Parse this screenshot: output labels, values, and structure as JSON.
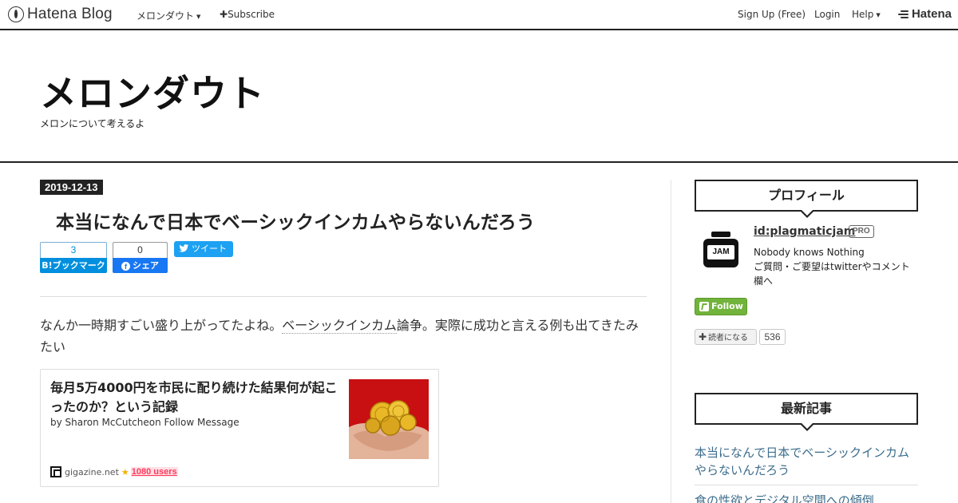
{
  "navbar": {
    "logo_text": "Hatena Blog",
    "blog_menu_label": "メロンダウト",
    "subscribe_label": "Subscribe",
    "signup_label": "Sign Up (Free)",
    "login_label": "Login",
    "help_label": "Help",
    "brand_label": "Hatena"
  },
  "header": {
    "title": "メロンダウト",
    "description": "メロンについて考えるよ"
  },
  "entry": {
    "date": "2019-12-13",
    "title": "本当になんで日本でベーシックインカムやらないんだろう",
    "bookmark": {
      "count": "3",
      "label": "B!ブックマーク"
    },
    "facebook": {
      "count": "0",
      "label": "シェア"
    },
    "tweet_label": "ツイート",
    "body_pre": "なんか一時期すごい盛り上がってたよね。",
    "body_keyword": "ベーシックインカム",
    "body_post": "論争。実際に成功と言える例も出てきたみたい",
    "embed": {
      "title": "毎月5万4000円を市民に配り続けた結果何が起こったのか？という記録",
      "description": "by Sharon McCutcheon Follow Message",
      "site": "gigazine.net",
      "users": "1080 users"
    }
  },
  "sidebar": {
    "profile_heading": "プロフィール",
    "profile_id": "id:plagmaticjam",
    "pro_label": "PRO",
    "avatar_text": "JAM",
    "profile_desc_line1": "Nobody knows Nothing",
    "profile_desc_line2": "ご質問・ご要望はtwitterやコメント欄へ",
    "follow_label": "Follow",
    "reader_label": "読者になる",
    "reader_count": "536",
    "recent_heading": "最新記事",
    "recent_items": [
      "本当になんで日本でベーシックインカムやらないんだろう",
      "食の性欲とデジタル空間への傾倒"
    ]
  },
  "colors": {
    "hatena_blue": "#008fde",
    "facebook_blue": "#1877f2",
    "twitter_blue": "#1da1f2",
    "follow_green": "#71b33b",
    "link_blue": "#3c6d8c"
  }
}
